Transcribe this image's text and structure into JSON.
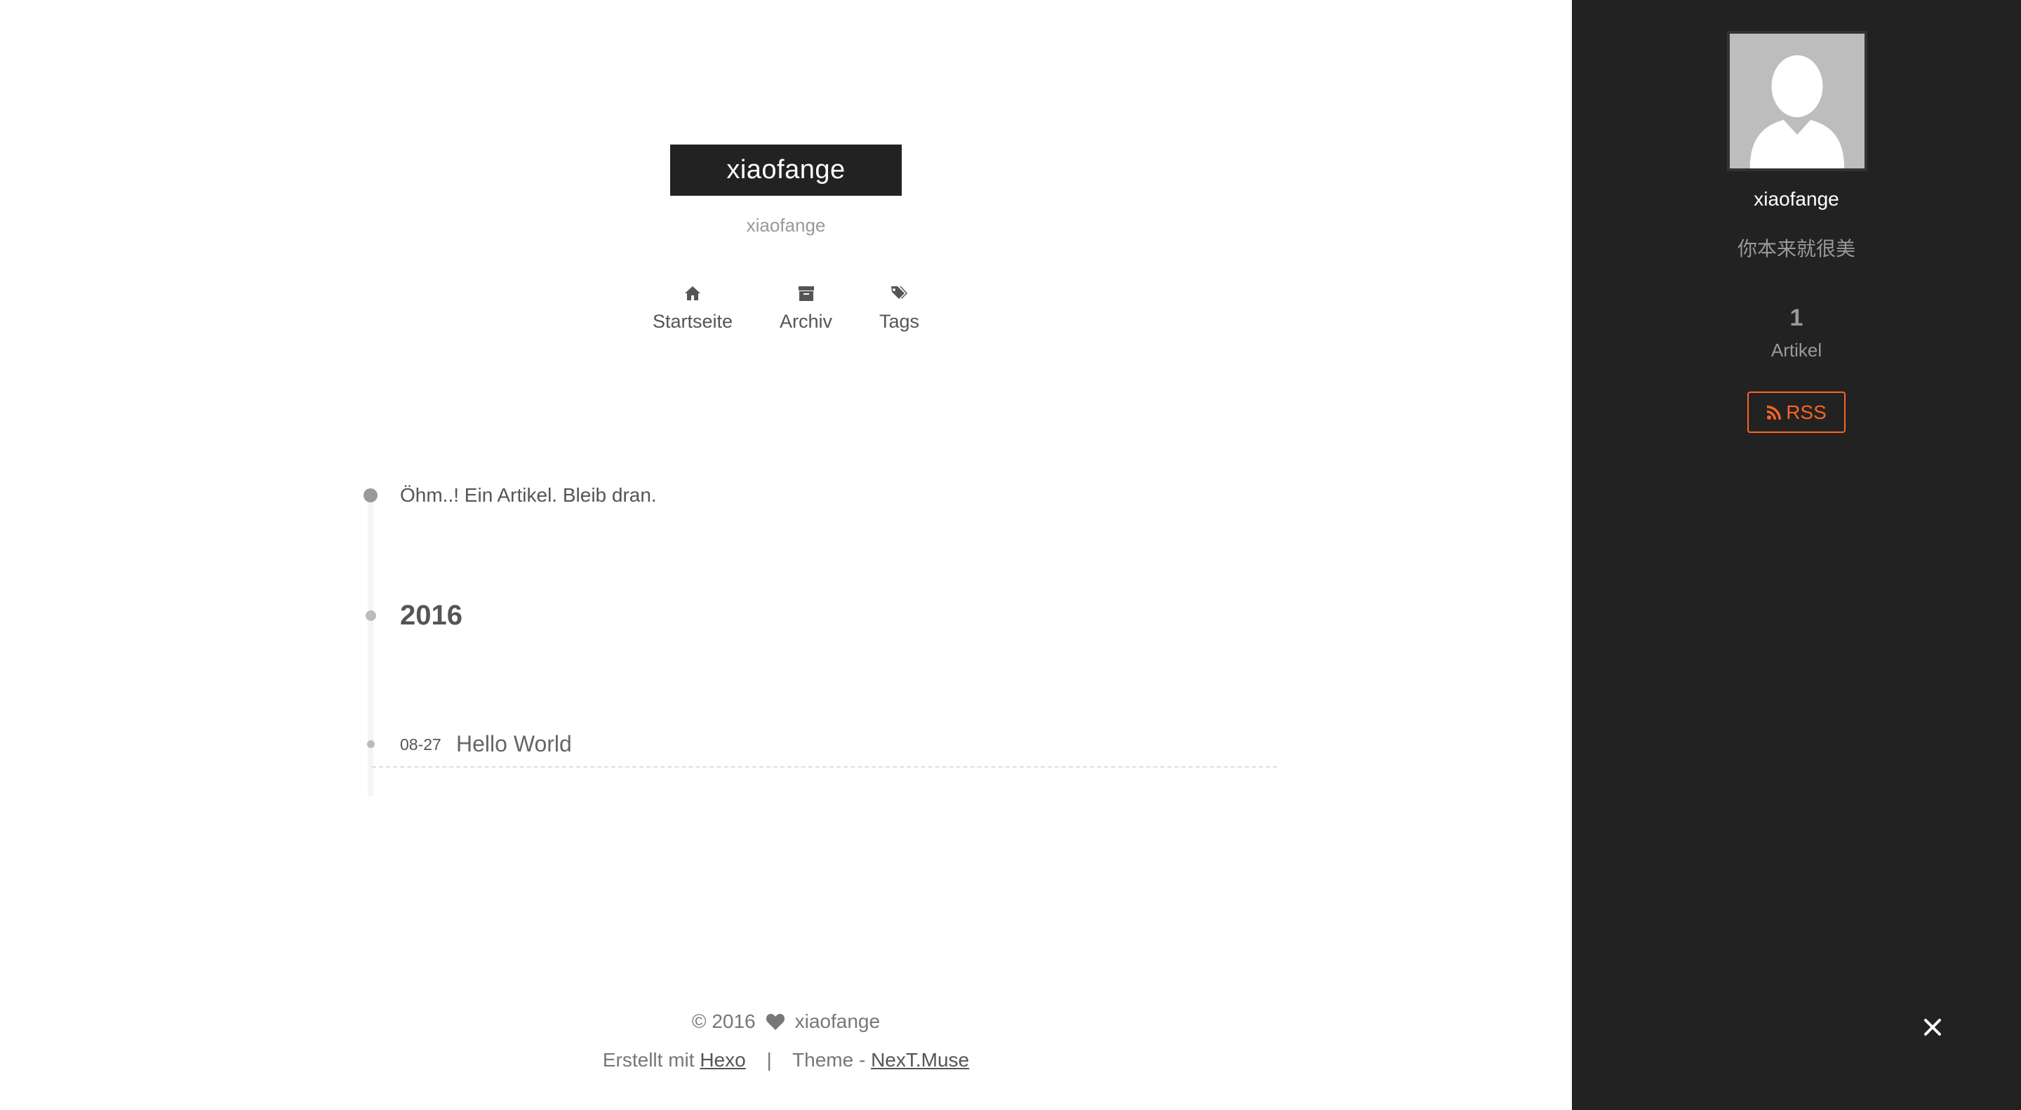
{
  "header": {
    "brand": "xiaofange",
    "subtitle": "xiaofange"
  },
  "menu": [
    {
      "label": "Startseite",
      "icon": "home-icon"
    },
    {
      "label": "Archiv",
      "icon": "archive-icon"
    },
    {
      "label": "Tags",
      "icon": "tags-icon"
    }
  ],
  "timeline": {
    "intro": "Öhm..! Ein Artikel. Bleib dran.",
    "year": "2016",
    "posts": [
      {
        "date": "08-27",
        "title": "Hello World"
      }
    ]
  },
  "footer": {
    "copyright": "© 2016",
    "heart_icon": "heart-icon",
    "author": "xiaofange",
    "built_with": "Erstellt mit",
    "hexo": "Hexo",
    "separator": "|",
    "theme_prefix": "Theme -",
    "theme": "NexT.Muse"
  },
  "sidebar": {
    "avatar_icon": "user-avatar-icon",
    "name": "xiaofange",
    "description": "你本来就很美",
    "posts_count": "1",
    "posts_label": "Artikel",
    "rss_label": "RSS",
    "close_icon": "close-icon"
  },
  "colors": {
    "sidebar_bg": "#222222",
    "brand_bg": "#222222",
    "rss_accent": "#fc6423"
  }
}
